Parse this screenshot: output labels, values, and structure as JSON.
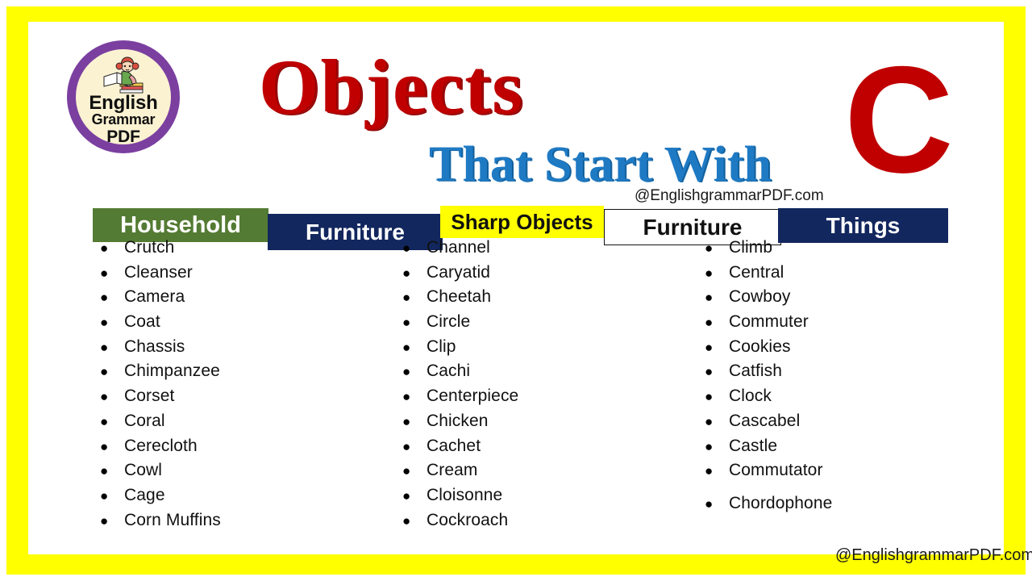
{
  "poster": {
    "title_main": "Objects",
    "title_sub": "That Start With",
    "big_letter": "C",
    "watermark_top": "@EnglishgrammarPDF.com",
    "watermark_bottom": "@EnglishgrammarPDF.com",
    "border_color": "#ffff00",
    "background_color": "#ffffff"
  },
  "logo": {
    "line1": "English",
    "line2": "Grammar",
    "line3": "PDF",
    "ring_color": "#7b3fa0",
    "face_color": "#fbf2d2",
    "icon": "girl-reading-books-icon"
  },
  "banners": [
    {
      "label": "Household",
      "bg": "#547b33",
      "fg": "#ffffff"
    },
    {
      "label": "Furniture",
      "bg": "#12275e",
      "fg": "#ffffff"
    },
    {
      "label": "Sharp Objects",
      "bg": "#ffff00",
      "fg": "#111111"
    },
    {
      "label": "Furniture",
      "bg": "#ffffff",
      "fg": "#111111"
    },
    {
      "label": "Things",
      "bg": "#12275e",
      "fg": "#ffffff"
    }
  ],
  "columns": [
    {
      "heading": "Household",
      "words": [
        "Crutch",
        "Cleanser",
        "Camera",
        "Coat",
        "Chassis",
        "Chimpanzee",
        "Corset",
        "Coral",
        "Cerecloth",
        "Cowl",
        "Cage",
        "Corn Muffins"
      ]
    },
    {
      "heading": "Sharp Objects",
      "words": [
        "Channel",
        "Caryatid",
        "Cheetah",
        "Circle",
        "Clip",
        "Cachi",
        "Centerpiece",
        "Chicken",
        "Cachet",
        "Cream",
        "Cloisonne",
        "Cockroach"
      ]
    },
    {
      "heading": "Things",
      "words": [
        "Climb",
        "Central",
        "Cowboy",
        "Commuter",
        "Cookies",
        "Catfish",
        "Clock",
        "Cascabel",
        "Castle",
        "Commutator",
        "Chordophone"
      ]
    }
  ],
  "bullet_glyph": "●"
}
